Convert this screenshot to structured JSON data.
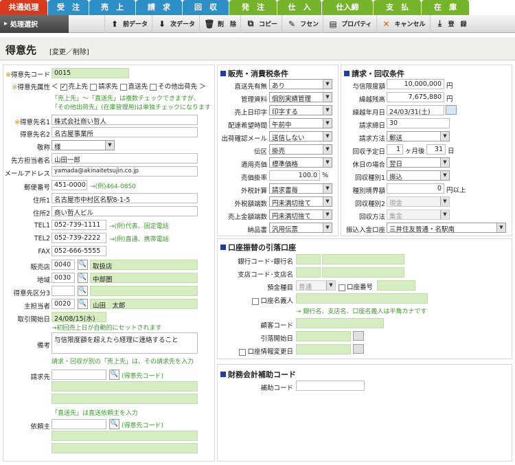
{
  "tabs": [
    {
      "label": "共通処理",
      "color": "#d73a1e"
    },
    {
      "label": "受　注",
      "color": "#2e8fc7"
    },
    {
      "label": "売　上",
      "color": "#2e8fc7"
    },
    {
      "label": "請　求",
      "color": "#2e8fc7"
    },
    {
      "label": "回　収",
      "color": "#2e8fc7"
    },
    {
      "label": "発　注",
      "color": "#75b32a"
    },
    {
      "label": "仕　入",
      "color": "#75b32a"
    },
    {
      "label": "仕入締",
      "color": "#75b32a"
    },
    {
      "label": "支　払",
      "color": "#75b32a"
    },
    {
      "label": "在　庫",
      "color": "#75b32a"
    }
  ],
  "toolbar": {
    "menu_label": "処理選択",
    "prev": "前データ",
    "next": "次データ",
    "delete": "削　除",
    "copy": "コピー",
    "fusen": "フセン",
    "property": "プロパティ",
    "cancel": "キャンセル",
    "register": "登　録"
  },
  "page": {
    "title": "得意先",
    "mode": "[変更／削除]"
  },
  "left": {
    "code_label": "得意先コード",
    "code_value": "0015",
    "attr_label": "得意先属性",
    "attr_options": [
      "売上先",
      "請求先",
      "直送先",
      "その他出荷先"
    ],
    "attr_note1": "「売上先」～「直送先」は複数チェックできますが、",
    "attr_note2": "「その他出荷先」(在庫管理用)は単独チェックになります",
    "name1_label": "得意先名1",
    "name1_value": "株式会社商い哲人",
    "name2_label": "得意先名2",
    "name2_value": "名古屋事業所",
    "honor_label": "敬称",
    "honor_value": "様",
    "contact_label": "先方担当者名",
    "contact_value": "山田一郎",
    "mail_label": "メールアドレス",
    "mail_value": "yamada@akinaitetsujin.co.jp",
    "zip_label": "郵便番号",
    "zip_value": "451-0000",
    "zip_hint": "→(例)464-0850",
    "addr1_label": "住所1",
    "addr1_value": "名古屋市中村区名駅8-1-5",
    "addr2_label": "住所2",
    "addr2_value": "商い哲人ビル",
    "tel1_label": "TEL1",
    "tel1_value": "052-739-1111",
    "tel1_hint": "→(例)代表、固定電話",
    "tel2_label": "TEL2",
    "tel2_value": "052-739-2222",
    "tel2_hint": "→(例)直通、携帯電話",
    "fax_label": "FAX",
    "fax_value": "052-666-5555",
    "shop_label": "販売店",
    "shop_code": "0040",
    "shop_name": "取扱店",
    "area_label": "地域",
    "area_code": "0030",
    "area_name": "中部圏",
    "cat3_label": "得意先区分3",
    "staff_label": "主担当者",
    "staff_code": "0020",
    "staff_name": "山田　太郎",
    "start_label": "取引開始日",
    "start_value": "24/08/15(水)",
    "start_note": "→初回売上日が自動的にセットされます",
    "remarks_label": "備考",
    "remarks_value": "与信限度額を超えたら経理に連絡すること",
    "remarks_note": "請求・回収が別の「売上先」は、その請求先を入力",
    "billto_label": "請求先",
    "billto_hint": "(得意先コード)",
    "client_note": "「直送先」は直送依頼主を入力",
    "client_label": "依頼主",
    "client_hint": "(得意先コード)"
  },
  "sales": {
    "title": "販売・消費税条件",
    "rows": [
      {
        "label": "直送先有無",
        "value": "あり",
        "type": "select"
      },
      {
        "label": "管理資料",
        "value": "個別実績管理",
        "type": "select"
      },
      {
        "label": "売上日印字",
        "value": "印字する",
        "type": "select"
      },
      {
        "label": "配達希望時間",
        "value": "午前中",
        "type": "select"
      },
      {
        "label": "出荷確認メール",
        "value": "送信しない",
        "type": "select"
      },
      {
        "label": "伝区",
        "value": "掛売",
        "type": "select"
      },
      {
        "label": "適用売価",
        "value": "標準価格",
        "type": "select"
      },
      {
        "label": "売価掛率",
        "value": "100.0",
        "type": "text",
        "unit": "%"
      },
      {
        "label": "外税計算",
        "value": "請求書毎",
        "type": "select"
      },
      {
        "label": "外税額端数",
        "value": "円未満切捨て",
        "type": "select"
      },
      {
        "label": "売上金額端数",
        "value": "円未満切捨て",
        "type": "select"
      },
      {
        "label": "納品書",
        "value": "汎用伝票",
        "type": "select"
      }
    ]
  },
  "billing": {
    "title": "請求・回収条件",
    "credit_label": "与信限度額",
    "credit_value": "10,000,000",
    "yen": "円",
    "carry_label": "繰越残高",
    "carry_value": "7,675,880",
    "carry_date_label": "繰越年月日",
    "carry_date_value": "24/03/31(土)",
    "close_label": "請求締日",
    "close_value": "30",
    "method_label": "請求方法",
    "method_value": "郵送",
    "due_label": "回収予定日",
    "due_month": "1",
    "due_month_unit": "ヶ月後",
    "due_day": "31",
    "due_day_unit": "日",
    "holiday_label": "休日の場合",
    "holiday_value": "翌日",
    "kind1_label": "回収種別1",
    "kind1_value": "振込",
    "border_label": "種別境界額",
    "border_value": "0",
    "border_unit": "円以上",
    "kind2_label": "回収種別2",
    "kind2_value": "現金",
    "way_label": "回収方法",
    "way_value": "集金",
    "bank_label": "振込入金口座",
    "bank_value": "三井住友普通・名駅南"
  },
  "debit": {
    "title": "口座振替の引落口座",
    "bank_label": "銀行コード･銀行名",
    "branch_label": "支店コード･支店名",
    "type_label": "預金種目",
    "type_value": "普通",
    "acct_label": "口座番号",
    "holder_label": "口座名義人",
    "note": "→ 銀行名、支店名、口座名義人は半角カナです",
    "cust_label": "顧客コード",
    "start_label": "引落開始日",
    "change_label": "口座情報変更日"
  },
  "accounting": {
    "title": "財務会計補助コード",
    "sub_label": "補助コード"
  }
}
